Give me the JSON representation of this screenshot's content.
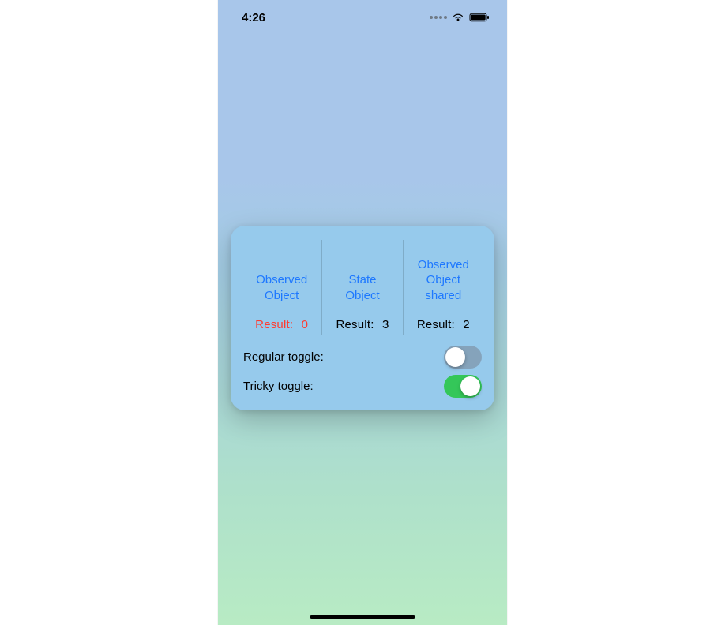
{
  "status": {
    "time": "4:26"
  },
  "card": {
    "columns": [
      {
        "labelA": "Observed",
        "labelB": "Object",
        "resultLabel": "Result:",
        "value": "0",
        "red": true
      },
      {
        "labelA": "State",
        "labelB": "Object",
        "resultLabel": "Result:",
        "value": "3",
        "red": false
      },
      {
        "labelA": "Observed",
        "labelB": "Object",
        "labelC": "shared",
        "resultLabel": "Result:",
        "value": "2",
        "red": false
      }
    ],
    "toggles": {
      "regular": {
        "label": "Regular toggle:",
        "on": false
      },
      "tricky": {
        "label": "Tricky toggle:",
        "on": true
      }
    }
  }
}
